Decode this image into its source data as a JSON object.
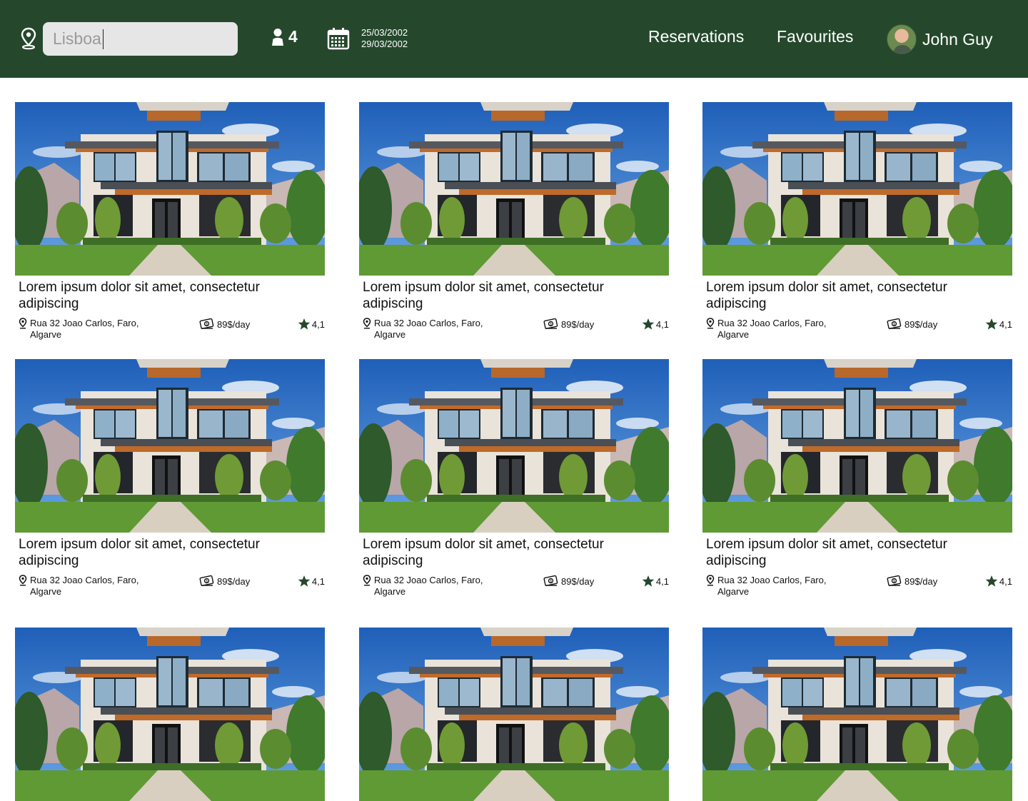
{
  "search": {
    "value": "Lisboa"
  },
  "guests": {
    "count": "4"
  },
  "dates": {
    "check_in": "25/03/2002",
    "check_out": "29/03/2002"
  },
  "nav": {
    "reservations": "Reservations",
    "favourites": "Favourites"
  },
  "user": {
    "name": "John Guy"
  },
  "colors": {
    "header": "#25482c",
    "search_bg": "#e6e6e6",
    "icon_green": "#25482c"
  },
  "listings": [
    {
      "title": "Lorem ipsum dolor sit amet, consectetur adipiscing",
      "address_line1": "Rua 32 Joao Carlos, Faro,",
      "address_line2": "Algarve",
      "price": "89$/day",
      "rating": "4,1"
    },
    {
      "title": "Lorem ipsum dolor sit amet, consectetur adipiscing",
      "address_line1": "Rua 32 Joao Carlos, Faro,",
      "address_line2": "Algarve",
      "price": "89$/day",
      "rating": "4,1"
    },
    {
      "title": "Lorem ipsum dolor sit amet, consectetur adipiscing",
      "address_line1": "Rua 32 Joao Carlos, Faro,",
      "address_line2": "Algarve",
      "price": "89$/day",
      "rating": "4,1"
    },
    {
      "title": "Lorem ipsum dolor sit amet, consectetur adipiscing",
      "address_line1": "Rua 32 Joao Carlos, Faro,",
      "address_line2": "Algarve",
      "price": "89$/day",
      "rating": "4,1"
    },
    {
      "title": "Lorem ipsum dolor sit amet, consectetur adipiscing",
      "address_line1": "Rua 32 Joao Carlos, Faro,",
      "address_line2": "Algarve",
      "price": "89$/day",
      "rating": "4,1"
    },
    {
      "title": "Lorem ipsum dolor sit amet, consectetur adipiscing",
      "address_line1": "Rua 32 Joao Carlos, Faro,",
      "address_line2": "Algarve",
      "price": "89$/day",
      "rating": "4,1"
    }
  ]
}
